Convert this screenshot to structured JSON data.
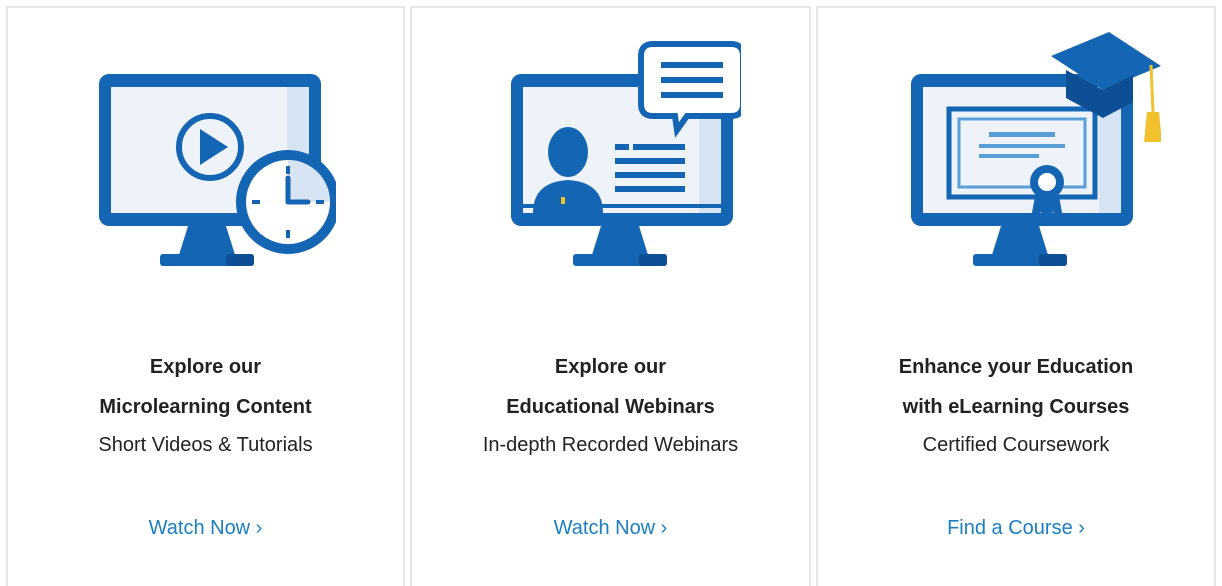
{
  "cards": [
    {
      "title_line1": "Explore our",
      "title_line2": "Microlearning Content",
      "subtitle": "Short Videos & Tutorials",
      "cta": "Watch Now ›"
    },
    {
      "title_line1": "Explore our",
      "title_line2": "Educational Webinars",
      "subtitle": "In-depth Recorded Webinars",
      "cta": "Watch Now ›"
    },
    {
      "title_line1": "Enhance your Education",
      "title_line2": "with eLearning Courses",
      "subtitle": "Certified Coursework",
      "cta": "Find a Course ›"
    }
  ],
  "colors": {
    "primary_blue": "#1565b5",
    "light_blue": "#5b9fd9",
    "screen_bg": "#eef3fa",
    "link": "#1a7fc1",
    "accent_yellow": "#f2c12e"
  }
}
